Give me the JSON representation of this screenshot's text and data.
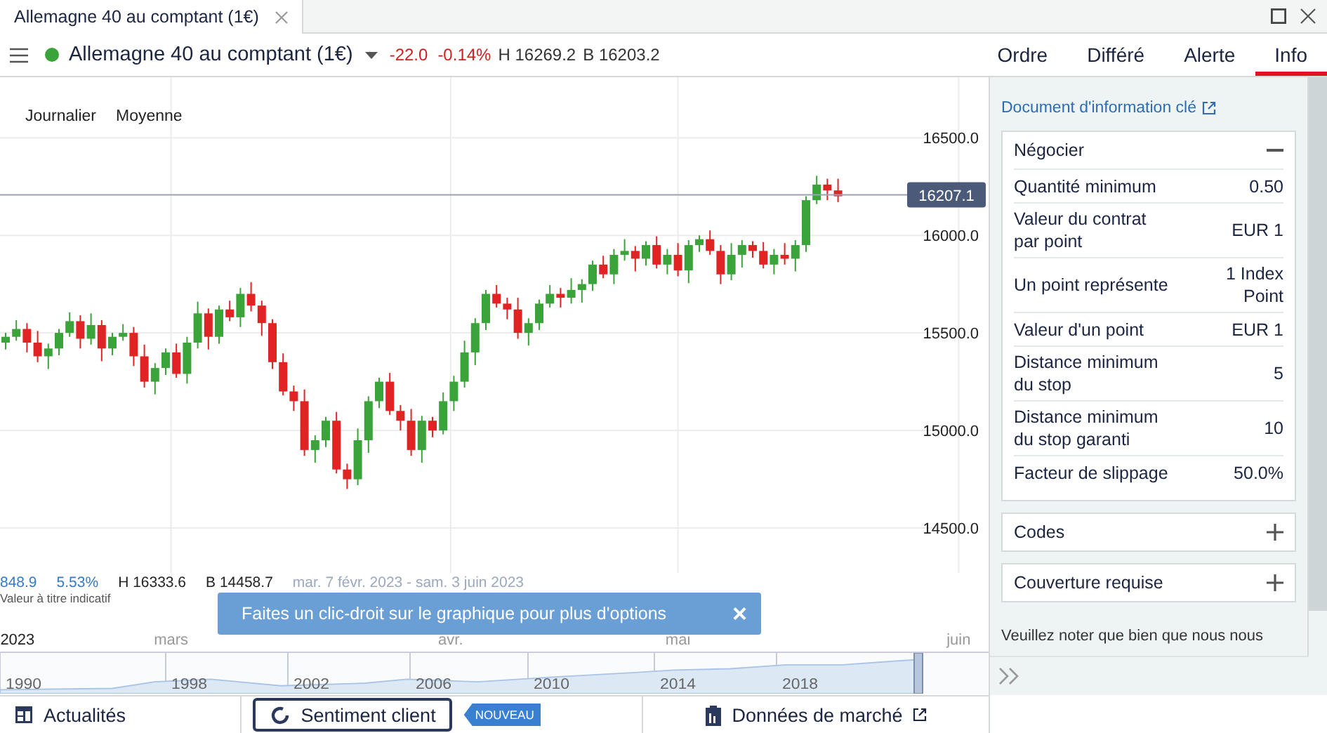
{
  "window": {
    "tab_title": "Allemagne 40 au comptant (1€)"
  },
  "instrument": {
    "name": "Allemagne 40 au comptant (1€)",
    "change": "-22.0",
    "change_pct": "-0.14%",
    "high": "H 16269.2",
    "low": "B 16203.2"
  },
  "nav_tabs": [
    {
      "label": "Ordre",
      "selected": false
    },
    {
      "label": "Différé",
      "selected": false
    },
    {
      "label": "Alerte",
      "selected": false
    },
    {
      "label": "Info",
      "selected": true
    }
  ],
  "chart": {
    "toolbar": [
      "Journalier",
      "Moyenne"
    ],
    "chart_data": {
      "type": "candlestick",
      "grid": true,
      "ylim": [
        14270,
        16810
      ],
      "ref_lines": [
        {
          "axis": "y",
          "value": 16207.1,
          "label": "16207.1"
        }
      ],
      "yticks": [
        {
          "value": 16500,
          "label": "16500.0"
        },
        {
          "value": 16000,
          "label": "16000.0"
        },
        {
          "value": 15500,
          "label": "15500.0"
        },
        {
          "value": 15000,
          "label": "15000.0"
        },
        {
          "value": 14500,
          "label": "14500.0"
        }
      ],
      "ohlc": [
        [
          15450,
          15500,
          15415,
          15480
        ],
        [
          15480,
          15565,
          15460,
          15520
        ],
        [
          15520,
          15550,
          15400,
          15450
        ],
        [
          15450,
          15510,
          15350,
          15380
        ],
        [
          15380,
          15445,
          15315,
          15420
        ],
        [
          15420,
          15520,
          15385,
          15500
        ],
        [
          15500,
          15605,
          15480,
          15560
        ],
        [
          15560,
          15590,
          15420,
          15470
        ],
        [
          15470,
          15600,
          15440,
          15540
        ],
        [
          15540,
          15565,
          15355,
          15420
        ],
        [
          15420,
          15500,
          15385,
          15480
        ],
        [
          15480,
          15545,
          15460,
          15500
        ],
        [
          15500,
          15530,
          15330,
          15380
        ],
        [
          15380,
          15440,
          15220,
          15250
        ],
        [
          15250,
          15345,
          15185,
          15320
        ],
        [
          15320,
          15420,
          15285,
          15400
        ],
        [
          15400,
          15445,
          15270,
          15290
        ],
        [
          15290,
          15480,
          15240,
          15450
        ],
        [
          15450,
          15660,
          15420,
          15600
        ],
        [
          15600,
          15625,
          15415,
          15480
        ],
        [
          15480,
          15640,
          15445,
          15620
        ],
        [
          15620,
          15665,
          15560,
          15580
        ],
        [
          15580,
          15730,
          15530,
          15700
        ],
        [
          15700,
          15760,
          15610,
          15640
        ],
        [
          15640,
          15665,
          15485,
          15550
        ],
        [
          15550,
          15570,
          15315,
          15350
        ],
        [
          15350,
          15395,
          15180,
          15200
        ],
        [
          15200,
          15230,
          15100,
          15150
        ],
        [
          15150,
          15210,
          14870,
          14900
        ],
        [
          14900,
          14975,
          14835,
          14950
        ],
        [
          14950,
          15070,
          14915,
          15050
        ],
        [
          15050,
          15095,
          14780,
          14800
        ],
        [
          14800,
          14830,
          14700,
          14750
        ],
        [
          14750,
          15010,
          14720,
          14950
        ],
        [
          14950,
          15175,
          14885,
          15150
        ],
        [
          15150,
          15270,
          15115,
          15250
        ],
        [
          15250,
          15295,
          15080,
          15100
        ],
        [
          15100,
          15130,
          15000,
          15050
        ],
        [
          15050,
          15110,
          14870,
          14900
        ],
        [
          14900,
          15075,
          14835,
          15050
        ],
        [
          15050,
          15070,
          14965,
          15000
        ],
        [
          15000,
          15195,
          14980,
          15150
        ],
        [
          15150,
          15280,
          15100,
          15250
        ],
        [
          15250,
          15460,
          15220,
          15400
        ],
        [
          15400,
          15575,
          15335,
          15550
        ],
        [
          15550,
          15720,
          15515,
          15700
        ],
        [
          15700,
          15745,
          15630,
          15650
        ],
        [
          15650,
          15680,
          15570,
          15620
        ],
        [
          15620,
          15680,
          15470,
          15500
        ],
        [
          15500,
          15575,
          15435,
          15550
        ],
        [
          15550,
          15670,
          15515,
          15650
        ],
        [
          15650,
          15745,
          15630,
          15700
        ],
        [
          15700,
          15730,
          15630,
          15680
        ],
        [
          15680,
          15780,
          15650,
          15720
        ],
        [
          15720,
          15775,
          15655,
          15750
        ],
        [
          15750,
          15870,
          15715,
          15850
        ],
        [
          15850,
          15895,
          15780,
          15800
        ],
        [
          15800,
          15930,
          15750,
          15900
        ],
        [
          15900,
          15980,
          15870,
          15920
        ],
        [
          15920,
          15945,
          15815,
          15880
        ],
        [
          15880,
          15970,
          15845,
          15950
        ],
        [
          15950,
          15995,
          15830,
          15850
        ],
        [
          15850,
          15930,
          15800,
          15900
        ],
        [
          15900,
          15960,
          15790,
          15820
        ],
        [
          15820,
          15975,
          15755,
          15950
        ],
        [
          15950,
          16000,
          15915,
          15980
        ],
        [
          15980,
          16025,
          15900,
          15920
        ],
        [
          15920,
          15950,
          15750,
          15800
        ],
        [
          15800,
          15960,
          15770,
          15900
        ],
        [
          15900,
          15975,
          15835,
          15950
        ],
        [
          15950,
          15970,
          15885,
          15920
        ],
        [
          15920,
          15965,
          15830,
          15850
        ],
        [
          15850,
          15930,
          15800,
          15900
        ],
        [
          15900,
          15960,
          15850,
          15880
        ],
        [
          15880,
          15975,
          15815,
          15950
        ],
        [
          15950,
          16200,
          15915,
          16180
        ],
        [
          16180,
          16305,
          16160,
          16260
        ],
        [
          16260,
          16290,
          16180,
          16230
        ],
        [
          16230,
          16290,
          16170,
          16200
        ]
      ]
    },
    "stats": {
      "change": "848.9",
      "change_pct": "5.53%",
      "high": "H 16333.6",
      "low": "B 14458.7",
      "range": "mar. 7 févr. 2023 - sam. 3 juin 2023"
    },
    "note": "Valeur à titre indicatif",
    "x_labels": [
      "2023",
      "mars",
      "avr.",
      "mai",
      "juin"
    ],
    "navigator_years": [
      "1990",
      "1998",
      "2002",
      "2006",
      "2010",
      "2014",
      "2018"
    ]
  },
  "toast": {
    "message": "Faites un clic-droit sur le graphique pour plus d'options",
    "close": "×"
  },
  "info_panel": {
    "doc_link": "Document d'information clé",
    "sections": [
      {
        "title": "Négocier",
        "expanded": true,
        "rows": [
          {
            "label": "Quantité minimum",
            "value": "0.50"
          },
          {
            "label": "Valeur du contrat\npar point",
            "value": "EUR 1"
          },
          {
            "label": "Un point représente",
            "value": "1 Index\nPoint"
          },
          {
            "label": "Valeur d'un point",
            "value": "EUR 1"
          },
          {
            "label": "Distance minimum\ndu stop",
            "value": "5"
          },
          {
            "label": "Distance minimum\ndu stop garanti",
            "value": "10"
          },
          {
            "label": "Facteur de slippage",
            "value": "50.0%"
          }
        ]
      },
      {
        "title": "Codes",
        "expanded": false
      },
      {
        "title": "Couverture requise",
        "expanded": false
      }
    ],
    "notice": "Veuillez noter que bien que nous nous"
  },
  "bottom_bar": [
    {
      "label": "Actualités",
      "kind": "news"
    },
    {
      "label": "Sentiment client",
      "kind": "outlined",
      "badge": "NOUVEAU"
    },
    {
      "label": "Données de marché",
      "kind": "external"
    }
  ]
}
